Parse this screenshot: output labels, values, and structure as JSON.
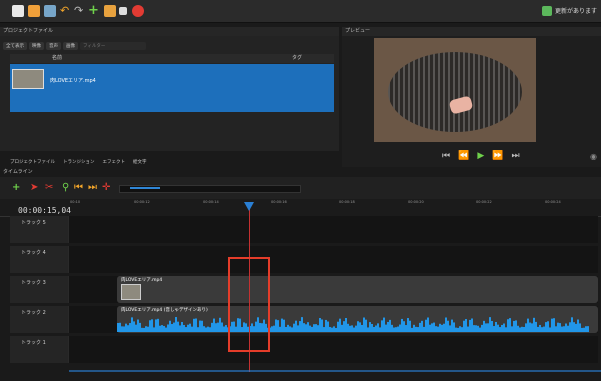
{
  "toolbar": {
    "update_label": "更新があります"
  },
  "project_files": {
    "title": "プロジェクトファイル",
    "filters": [
      "全て表示",
      "映像",
      "音声",
      "画像"
    ],
    "filter_placeholder": "フィルター",
    "columns": {
      "name": "名前",
      "tag": "タグ"
    },
    "files": [
      {
        "name": "肉LOVEエリア.mp4"
      }
    ]
  },
  "tabs": [
    "プロジェクトファイル",
    "トランジション",
    "エフェクト",
    "絵文字"
  ],
  "preview": {
    "title": "プレビュー"
  },
  "timeline": {
    "title": "タイムライン",
    "current_time": "00:00:15,04",
    "ticks": [
      "00:10",
      "00:00:12",
      "00:00:14",
      "00:00:16",
      "00:00:18",
      "00:00:20",
      "00:00:22",
      "00:00:24"
    ],
    "tracks": [
      {
        "name": "トラック 5"
      },
      {
        "name": "トラック 4"
      },
      {
        "name": "トラック 3",
        "clip": "肉LOVEエリア.mp4"
      },
      {
        "name": "トラック 2",
        "clip": "肉LOVEエリア.mp4 (音しゃデザインあり)"
      },
      {
        "name": "トラック 1"
      }
    ]
  },
  "colors": {
    "accent": "#1d6fbb",
    "playhead": "#c43131",
    "highlight": "#e53d2a",
    "wave": "#2196e8"
  }
}
